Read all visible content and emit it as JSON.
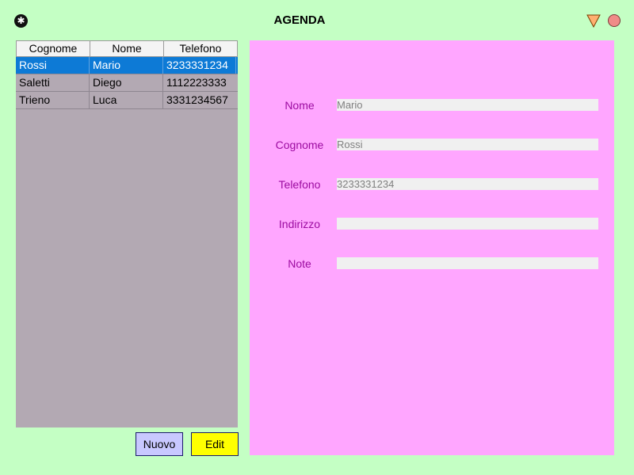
{
  "window": {
    "title": "AGENDA",
    "icons": {
      "app": "asterisk-icon",
      "minimize": "triangle-down-icon",
      "close": "circle-close-icon"
    },
    "colors": {
      "background": "#c4ffc4",
      "close": "#f08c88",
      "minimize": "#ffb070"
    }
  },
  "table": {
    "columns": [
      "Cognome",
      "Nome",
      "Telefono"
    ],
    "rows": [
      [
        "Rossi",
        "Mario",
        "3233331234"
      ],
      [
        "Saletti",
        "Diego",
        "1112223333"
      ],
      [
        "Trieno",
        "Luca",
        "3331234567"
      ]
    ],
    "selected_row": 0,
    "colors": {
      "background": "#b3a9b3",
      "selection": "#0d7ad6"
    }
  },
  "buttons": {
    "nuovo": "Nuovo",
    "edit": "Edit"
  },
  "form": {
    "fields": [
      {
        "label": "Nome",
        "value": "Mario"
      },
      {
        "label": "Cognome",
        "value": "Rossi"
      },
      {
        "label": "Telefono",
        "value": "3233331234"
      },
      {
        "label": "Indirizzo",
        "value": ""
      },
      {
        "label": "Note",
        "value": ""
      }
    ],
    "colors": {
      "background": "#ffa6ff",
      "label": "#9c0ca0"
    }
  }
}
